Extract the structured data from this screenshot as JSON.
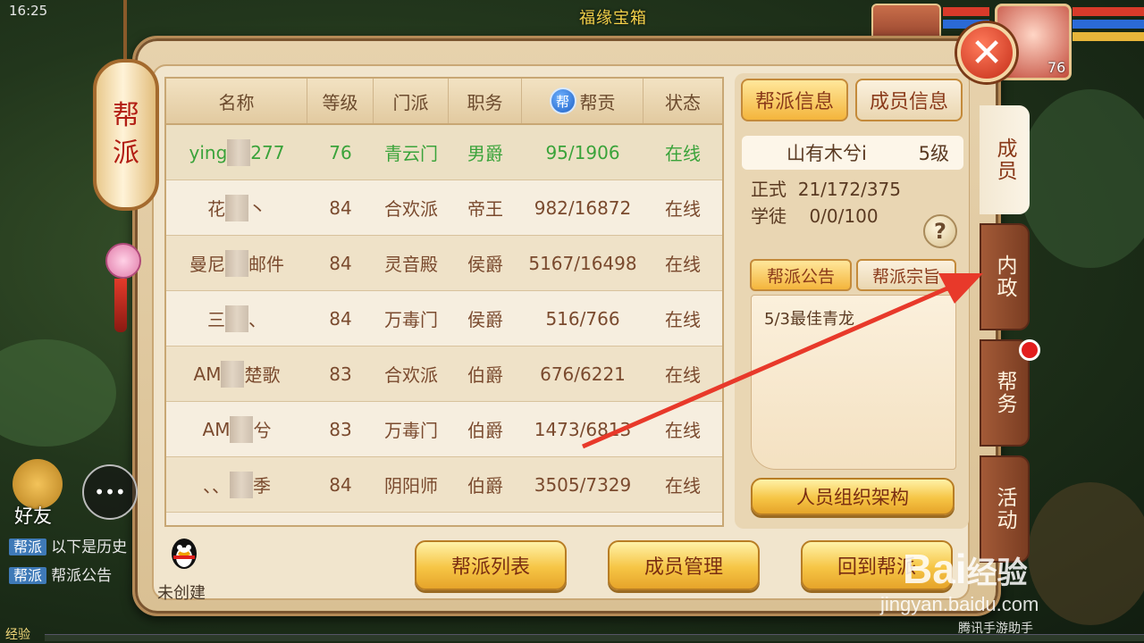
{
  "status_bar": {
    "time": "16:25"
  },
  "game": {
    "top_title": "福缘宝箱"
  },
  "lantern": {
    "label_line1": "帮",
    "label_line2": "派"
  },
  "table": {
    "headers": {
      "name": "名称",
      "level": "等级",
      "sect": "门派",
      "position": "职务",
      "contribution_icon": "帮",
      "contribution": "帮贡",
      "status": "状态"
    },
    "rows": [
      {
        "name_pre": "ying",
        "name_post": "277",
        "level": "76",
        "sect": "青云门",
        "position": "男爵",
        "contribution": "95/1906",
        "status": "在线"
      },
      {
        "name_pre": "花",
        "name_post": "丶",
        "level": "84",
        "sect": "合欢派",
        "position": "帝王",
        "contribution": "982/16872",
        "status": "在线"
      },
      {
        "name_pre": "曼尼",
        "name_post": "邮件",
        "level": "84",
        "sect": "灵音殿",
        "position": "侯爵",
        "contribution": "5167/16498",
        "status": "在线"
      },
      {
        "name_pre": "三",
        "name_post": "、",
        "level": "84",
        "sect": "万毒门",
        "position": "侯爵",
        "contribution": "516/766",
        "status": "在线"
      },
      {
        "name_pre": "AM",
        "name_post": "楚歌",
        "level": "83",
        "sect": "合欢派",
        "position": "伯爵",
        "contribution": "676/6221",
        "status": "在线"
      },
      {
        "name_pre": "AM",
        "name_post": "兮",
        "level": "83",
        "sect": "万毒门",
        "position": "伯爵",
        "contribution": "1473/6813",
        "status": "在线"
      },
      {
        "name_pre": "、、",
        "name_post": "季",
        "level": "84",
        "sect": "阴阳师",
        "position": "伯爵",
        "contribution": "3505/7329",
        "status": "在线"
      }
    ]
  },
  "info_panel": {
    "tab_guild_info": "帮派信息",
    "tab_member_info": "成员信息",
    "guild_name": "山有木兮i",
    "guild_level": "5级",
    "formal_label": "正式",
    "formal_value": "21/172/375",
    "apprentice_label": "学徒",
    "apprentice_value": "0/0/100",
    "help": "?",
    "subtab_notice": "帮派公告",
    "subtab_purpose": "帮派宗旨",
    "notice_text": "5/3最佳青龙",
    "org_button": "人员组织架构"
  },
  "side_tabs": {
    "members": "成员",
    "internal": "内政",
    "affairs": "帮务",
    "activity": "活动"
  },
  "bottom_buttons": {
    "guild_list": "帮派列表",
    "member_manage": "成员管理",
    "back": "回到帮派"
  },
  "qq": {
    "label": "未创建"
  },
  "left_hud": {
    "friends": "好友",
    "chat_icon": "•••",
    "exp_label": "经验"
  },
  "chat": [
    {
      "tag": "帮派",
      "text": "以下是历史"
    },
    {
      "tag": "帮派",
      "text": "帮派公告"
    }
  ],
  "close_button": {
    "glyph": "✕"
  },
  "avatar": {
    "level": "76"
  },
  "watermark": {
    "brand": "Bai",
    "brand_cn": "经验",
    "url": "jingyan.baidu.com",
    "sub": "腾讯手游助手"
  },
  "colors": {
    "panel": "#e7d2ad",
    "online_self": "#3aa33a",
    "accent": "#f4b53c",
    "arrow": "#e8392a"
  }
}
